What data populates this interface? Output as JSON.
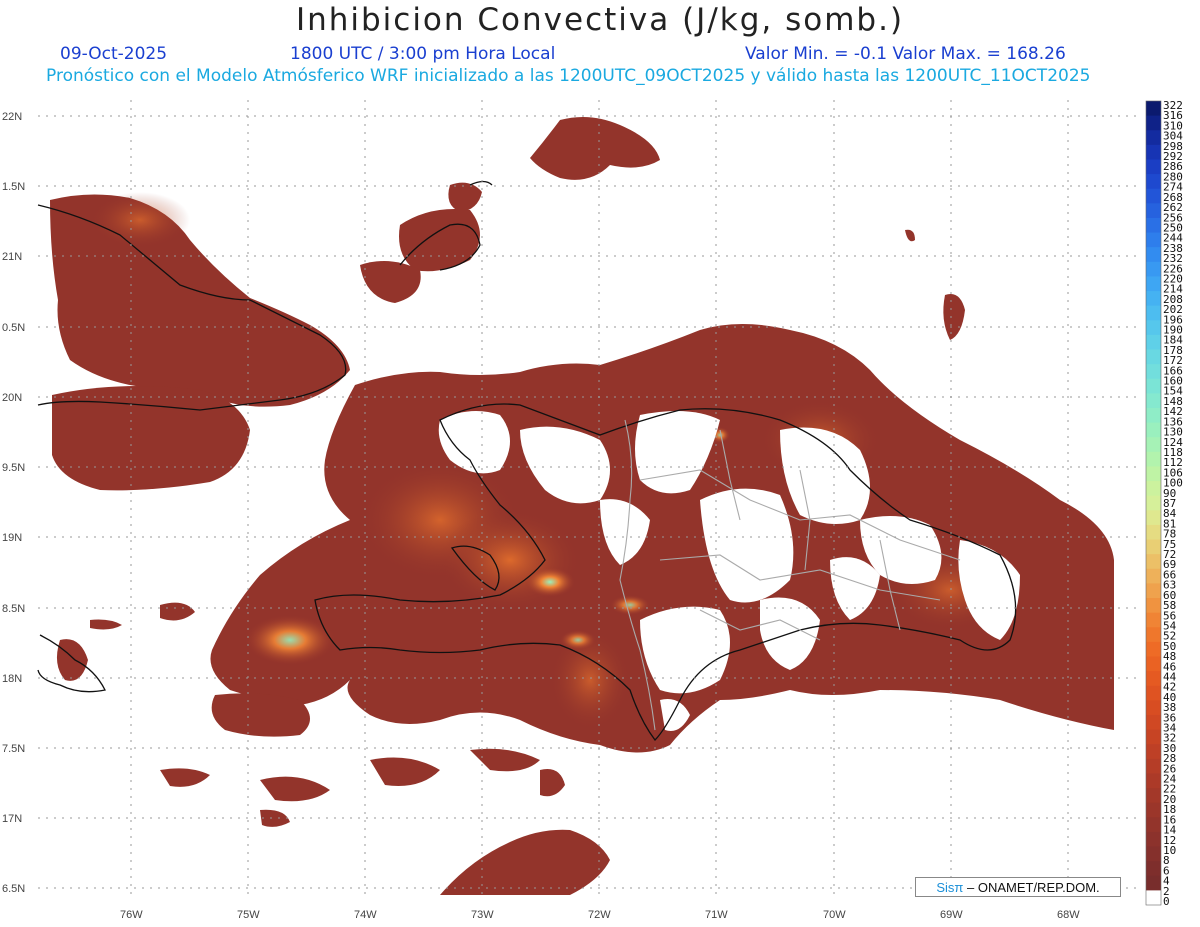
{
  "title": "Inhibicion Convectiva (J/kg, somb.)",
  "header": {
    "date": "09-Oct-2025",
    "time": "1800 UTC / 3:00 pm Hora Local",
    "min_max": "Valor Min. = -0.1  Valor Max. = 168.26",
    "subtitle": "Pronóstico con el Modelo Atmósferico WRF inicializado a las 1200UTC_09OCT2025 y válido hasta las  1200UTC_11OCT2025"
  },
  "lat_labels": [
    "22N",
    "1.5N",
    "21N",
    "0.5N",
    "20N",
    "9.5N",
    "19N",
    "8.5N",
    "18N",
    "7.5N",
    "17N",
    "6.5N"
  ],
  "lon_labels": [
    "76W",
    "75W",
    "74W",
    "73W",
    "72W",
    "71W",
    "70W",
    "69W",
    "68W"
  ],
  "colorbar": {
    "labels": [
      "322",
      "316",
      "310",
      "304",
      "298",
      "292",
      "286",
      "280",
      "274",
      "268",
      "262",
      "256",
      "250",
      "244",
      "238",
      "232",
      "226",
      "220",
      "214",
      "208",
      "202",
      "196",
      "190",
      "184",
      "178",
      "172",
      "166",
      "160",
      "154",
      "148",
      "142",
      "136",
      "130",
      "124",
      "118",
      "112",
      "106",
      "100",
      "90",
      "87",
      "84",
      "81",
      "78",
      "75",
      "72",
      "69",
      "66",
      "63",
      "60",
      "58",
      "56",
      "54",
      "52",
      "50",
      "48",
      "46",
      "44",
      "42",
      "40",
      "38",
      "36",
      "34",
      "32",
      "30",
      "28",
      "26",
      "24",
      "22",
      "20",
      "18",
      "16",
      "14",
      "12",
      "10",
      "8",
      "6",
      "4",
      "2",
      "0"
    ],
    "colors": [
      "#0b1a6e",
      "#0f2288",
      "#132ba0",
      "#1734b4",
      "#1b3ec4",
      "#1e49cf",
      "#2255d8",
      "#2662df",
      "#2a70e6",
      "#2e7eec",
      "#328cf0",
      "#3899f2",
      "#3ea6f3",
      "#45b2f2",
      "#4dbdf0",
      "#56c7ec",
      "#5fd0e8",
      "#69d8e2",
      "#72dedd",
      "#7be4d6",
      "#85e9cf",
      "#8fedc7",
      "#9af0be",
      "#a6f2b6",
      "#b2f3ad",
      "#bff3a5",
      "#ccf29e",
      "#d6f09a",
      "#dfe88f",
      "#e5dc82",
      "#e9cf74",
      "#ecc067",
      "#eeb15a",
      "#efa24d",
      "#f09340",
      "#f08435",
      "#ef772c",
      "#ee6b26",
      "#ea6223",
      "#e55a22",
      "#df5322",
      "#d84d22",
      "#d04823",
      "#c74424",
      "#be4026",
      "#b53d27",
      "#ac3a28",
      "#a33829",
      "#9b362a",
      "#93342b",
      "#8c322c",
      "#85302c",
      "#7e2e2c",
      "#782d2c",
      "#ffffff"
    ],
    "label_max": "322",
    "label_min": "0"
  },
  "credit": {
    "sis": "Sisπ",
    "rest": "– ONAMET/REP.DOM."
  }
}
